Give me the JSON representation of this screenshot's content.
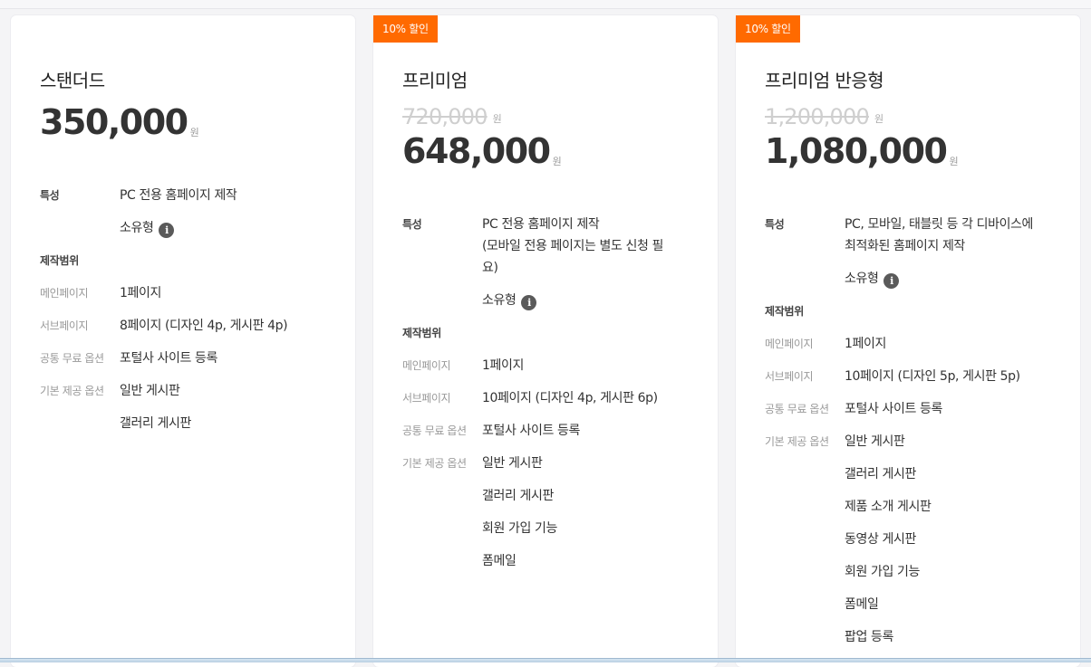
{
  "plans": [
    {
      "badge": "",
      "name": "스탠더드",
      "old_price": "",
      "price": "350,000",
      "currency": "원",
      "feature_label": "특성",
      "features": [
        "PC 전용 홈페이지 제작"
      ],
      "ownership": "소유형",
      "scope_label": "제작범위",
      "main_label": "메인페이지",
      "main_value": "1페이지",
      "sub_label": "서브페이지",
      "sub_value": "8페이지 (디자인 4p, 게시판 4p)",
      "common_label": "공통 무료 옵션",
      "common_value": "포털사 사이트 등록",
      "basic_label": "기본 제공 옵션",
      "basic_values": [
        "일반 게시판",
        "갤러리 게시판"
      ]
    },
    {
      "badge": "10% 할인",
      "name": "프리미엄",
      "old_price": "720,000",
      "price": "648,000",
      "currency": "원",
      "feature_label": "특성",
      "features": [
        "PC 전용 홈페이지 제작",
        "(모바일 전용 페이지는 별도 신청 필",
        "요)"
      ],
      "ownership": "소유형",
      "scope_label": "제작범위",
      "main_label": "메인페이지",
      "main_value": "1페이지",
      "sub_label": "서브페이지",
      "sub_value": "10페이지 (디자인 4p, 게시판 6p)",
      "common_label": "공통 무료 옵션",
      "common_value": "포털사 사이트 등록",
      "basic_label": "기본 제공 옵션",
      "basic_values": [
        "일반 게시판",
        "갤러리 게시판",
        "회원 가입 기능",
        "폼메일"
      ]
    },
    {
      "badge": "10% 할인",
      "name": "프리미엄 반응형",
      "old_price": "1,200,000",
      "price": "1,080,000",
      "currency": "원",
      "feature_label": "특성",
      "features": [
        "PC, 모바일, 태블릿 등 각 디바이스에",
        "최적화된 홈페이지 제작"
      ],
      "ownership": "소유형",
      "scope_label": "제작범위",
      "main_label": "메인페이지",
      "main_value": "1페이지",
      "sub_label": "서브페이지",
      "sub_value": "10페이지 (디자인 5p, 게시판 5p)",
      "common_label": "공통 무료 옵션",
      "common_value": "포털사 사이트 등록",
      "basic_label": "기본 제공 옵션",
      "basic_values": [
        "일반 게시판",
        "갤러리 게시판",
        "제품 소개 게시판",
        "동영상 게시판",
        "회원 가입 기능",
        "폼메일",
        "팝업 등록"
      ]
    }
  ],
  "colors": {
    "badge": "#ff6a00",
    "info_icon": "#5a5a5a"
  },
  "icons": {
    "ownership_info": "info-icon"
  },
  "info_glyph": "i"
}
